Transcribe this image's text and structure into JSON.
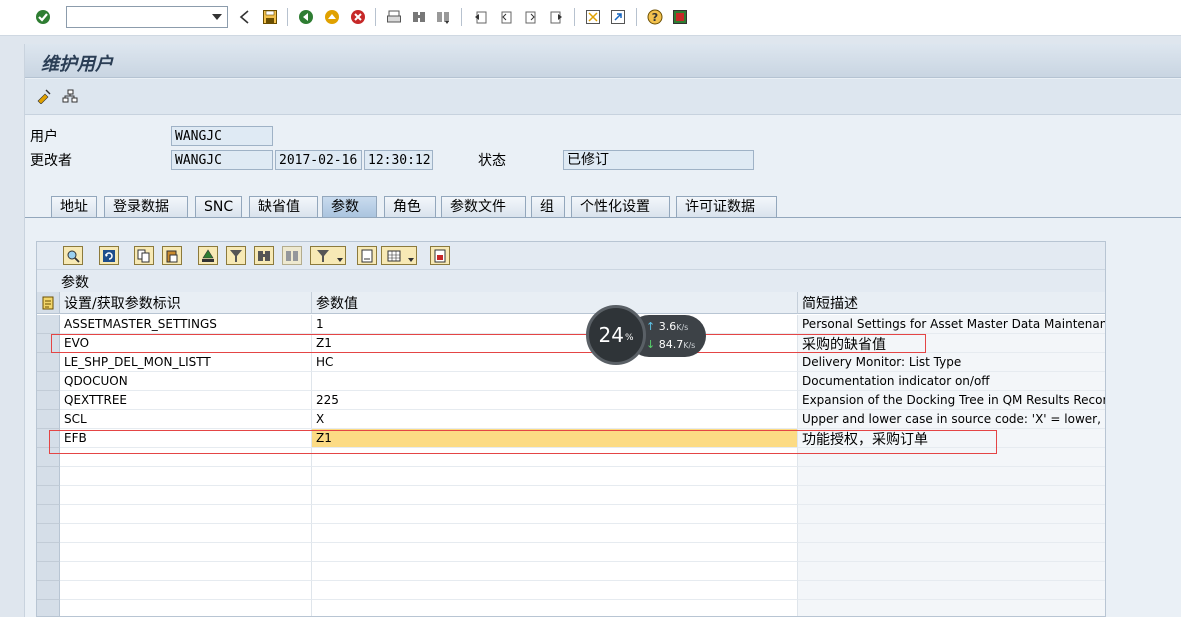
{
  "command_field": {
    "value": ""
  },
  "window": {
    "title": "维护用户"
  },
  "header": {
    "user_label": "用户",
    "user_value": "WANGJC",
    "changed_by_label": "更改者",
    "changed_by_value": "WANGJC",
    "date": "2017-02-16",
    "time": "12:30:12",
    "status_label": "状态",
    "status_value": "已修订"
  },
  "tabs": [
    {
      "label": "地址"
    },
    {
      "label": "登录数据"
    },
    {
      "label": "SNC"
    },
    {
      "label": "缺省值"
    },
    {
      "label": "参数",
      "active": true
    },
    {
      "label": "角色"
    },
    {
      "label": "参数文件"
    },
    {
      "label": "组"
    },
    {
      "label": "个性化设置"
    },
    {
      "label": "许可证数据"
    }
  ],
  "grid": {
    "title": "参数",
    "columns": [
      "设置/获取参数标识",
      "参数值",
      "简短描述"
    ],
    "rows": [
      {
        "id": "ASSETMASTER_SETTINGS",
        "value": "1",
        "desc": "Personal Settings for Asset Master Data Maintenance"
      },
      {
        "id": "EVO",
        "value": "Z1",
        "desc": "采购的缺省值"
      },
      {
        "id": "LE_SHP_DEL_MON_LISTT",
        "value": "HC",
        "desc": "Delivery Monitor: List Type"
      },
      {
        "id": "QDOCUON",
        "value": "",
        "desc": "Documentation indicator on/off"
      },
      {
        "id": "QEXTTREE",
        "value": "225",
        "desc": "Expansion of the Docking Tree in QM Results Recording"
      },
      {
        "id": "SCL",
        "value": "X",
        "desc": "Upper and lower case in source code: 'X' = lower, ' ' = upper"
      },
      {
        "id": "EFB",
        "value": "Z1",
        "desc": "功能授权，采购订单"
      }
    ]
  },
  "speed_widget": {
    "percent": "24",
    "percent_unit": "%",
    "upload": "3.6",
    "download": "84.7",
    "unit": "K/s"
  },
  "colors": {
    "highlight": "#fcdb84",
    "annotation": "#e44545",
    "title_text": "#2b3e55"
  }
}
